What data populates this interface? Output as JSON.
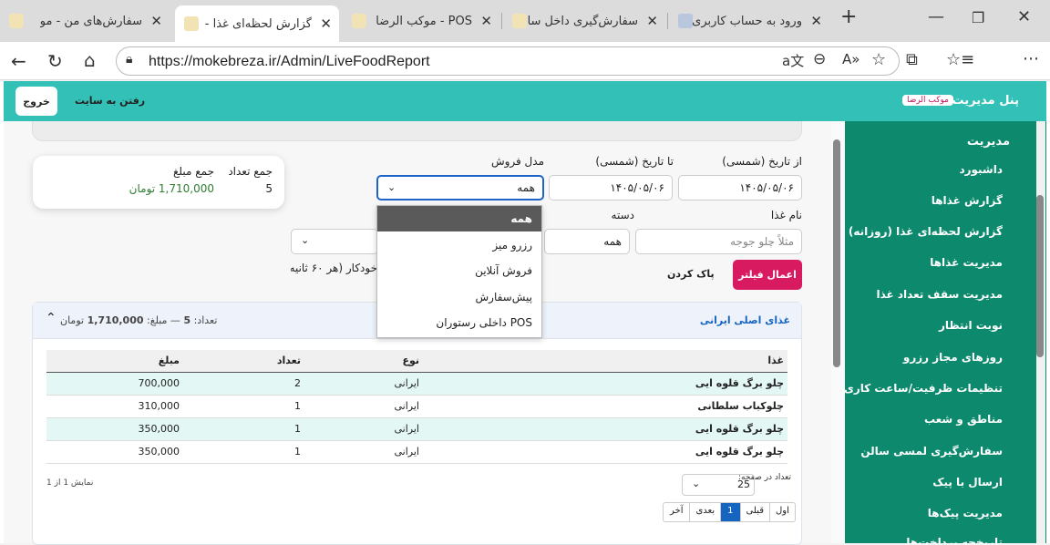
{
  "browser": {
    "tabs": [
      {
        "title": "سفارش‌های من - مو"
      },
      {
        "title": "گزارش لحظه‌ای غذا -"
      },
      {
        "title": "POS - موکب الرضا"
      },
      {
        "title": "سفارش‌گیری داخل سا"
      },
      {
        "title": "ورود به حساب کاربری"
      }
    ],
    "url": "https://mokebreza.ir/Admin/LiveFoodReport"
  },
  "topbar": {
    "exit_label": "خروج",
    "goto_site_label": "رفتن به سایت",
    "panel_title": "پنل مدیریت",
    "badge": "موکب الرضا"
  },
  "sidebar": {
    "heading": "مدیریت",
    "items": [
      {
        "label": "داشبورد"
      },
      {
        "label": "گزارش غذاها"
      },
      {
        "label": "گزارش لحظه‌ای غذا (روزانه)"
      },
      {
        "label": "مدیریت غذاها"
      },
      {
        "label": "مدیریت سقف تعداد غذا"
      },
      {
        "label": "نوبت انتظار"
      },
      {
        "label": "روزهای مجاز رزرو"
      },
      {
        "label": "تنظیمات ظرفیت/ساعت کاری"
      },
      {
        "label": "مناطق و شعب"
      },
      {
        "label": "سفارش‌گیری لمسی سالن"
      },
      {
        "label": "ارسال با پیک"
      },
      {
        "label": "مدیریت پیک‌ها"
      },
      {
        "label": "تاریخچه پرداخت‌ها"
      }
    ]
  },
  "filters": {
    "from_date_label": "از تاریخ (شمسی)",
    "from_date_value": "۱۴۰۵/۰۵/۰۶",
    "to_date_label": "تا تاریخ (شمسی)",
    "to_date_value": "۱۴۰۵/۰۵/۰۶",
    "sale_model_label": "مدل فروش",
    "sale_model_value": "همه",
    "food_name_label": "نام غذا",
    "food_name_placeholder": "مثلاً چلو جوجه",
    "category_label": "دسته",
    "category_value": "همه",
    "auto_refresh_label": "خودکار (هر ۶۰ ثانیه)",
    "apply_label": "اعمال فیلتر",
    "clear_label": "پاک کردن",
    "dropdown_options": [
      {
        "label": "همه",
        "selected": true
      },
      {
        "label": "رزرو میز"
      },
      {
        "label": "فروش آنلاین"
      },
      {
        "label": "پیش‌سفارش"
      },
      {
        "label": "POS داخلی رستوران"
      }
    ]
  },
  "summary": {
    "count_label": "جمع تعداد",
    "count_value": "5",
    "amount_label": "جمع مبلغ",
    "amount_value": "1,710,000 تومان"
  },
  "group": {
    "title": "غذای اصلی ایرانی",
    "count_prefix": "تعداد:",
    "count_value": "5",
    "amount_prefix": "— مبلغ:",
    "amount_value": "1,710,000",
    "amount_unit": "تومان",
    "columns": [
      "غذا",
      "نوع",
      "تعداد",
      "مبلغ"
    ],
    "rows": [
      {
        "food": "چلو برگ قلوه ایی",
        "type": "ایرانی",
        "count": "2",
        "amount": "700,000"
      },
      {
        "food": "چلوکباب سلطانی",
        "type": "ایرانی",
        "count": "1",
        "amount": "310,000"
      },
      {
        "food": "چلو برگ قلوه ایی",
        "type": "ایرانی",
        "count": "1",
        "amount": "350,000"
      },
      {
        "food": "چلو برگ قلوه ایی",
        "type": "ایرانی",
        "count": "1",
        "amount": "350,000"
      }
    ]
  },
  "pagination": {
    "per_page_label": "تعداد در صفحه:",
    "per_page_value": "25",
    "showing_label": "نمایش 1 از 1",
    "first": "اول",
    "prev": "قبلی",
    "current": "1",
    "next": "بعدی",
    "last": "آخر"
  },
  "colors": {
    "topbar": "#33c0b6",
    "sidebar": "#0d8a6e",
    "apply_button": "#d81b60",
    "row_highlight": "#e3f7f5",
    "link_blue": "#1565c0"
  }
}
